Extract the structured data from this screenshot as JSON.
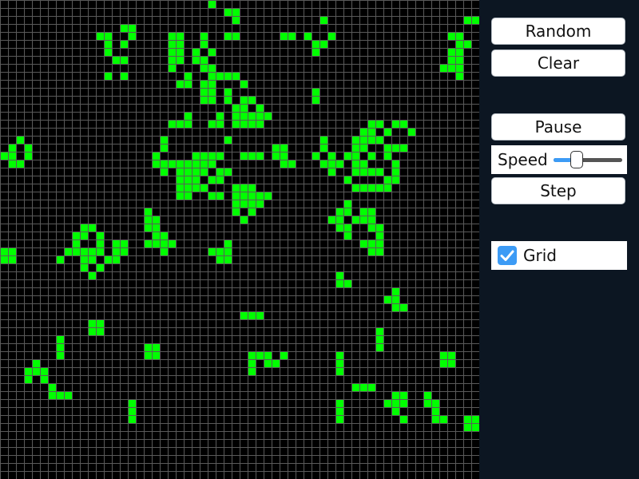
{
  "board": {
    "cols": 60,
    "rows": 60,
    "cell_color": "#00ff00",
    "grid_color": "#5a5a5a",
    "background": "#000000",
    "live_cells": [
      [
        26,
        0
      ],
      [
        28,
        1
      ],
      [
        29,
        1
      ],
      [
        15,
        3
      ],
      [
        16,
        3
      ],
      [
        29,
        2
      ],
      [
        40,
        2
      ],
      [
        58,
        2
      ],
      [
        59,
        2
      ],
      [
        12,
        4
      ],
      [
        13,
        4
      ],
      [
        16,
        4
      ],
      [
        21,
        4
      ],
      [
        22,
        4
      ],
      [
        25,
        4
      ],
      [
        28,
        4
      ],
      [
        29,
        4
      ],
      [
        35,
        4
      ],
      [
        36,
        4
      ],
      [
        38,
        4
      ],
      [
        41,
        4
      ],
      [
        56,
        4
      ],
      [
        57,
        4
      ],
      [
        13,
        5
      ],
      [
        15,
        5
      ],
      [
        21,
        5
      ],
      [
        22,
        5
      ],
      [
        25,
        5
      ],
      [
        39,
        5
      ],
      [
        40,
        5
      ],
      [
        57,
        5
      ],
      [
        58,
        5
      ],
      [
        13,
        6
      ],
      [
        21,
        6
      ],
      [
        22,
        6
      ],
      [
        24,
        6
      ],
      [
        26,
        6
      ],
      [
        39,
        6
      ],
      [
        56,
        6
      ],
      [
        57,
        6
      ],
      [
        15,
        7
      ],
      [
        14,
        7
      ],
      [
        21,
        7
      ],
      [
        22,
        7
      ],
      [
        24,
        7
      ],
      [
        25,
        7
      ],
      [
        56,
        7
      ],
      [
        57,
        7
      ],
      [
        21,
        8
      ],
      [
        25,
        8
      ],
      [
        26,
        8
      ],
      [
        55,
        8
      ],
      [
        56,
        8
      ],
      [
        57,
        8
      ],
      [
        13,
        9
      ],
      [
        15,
        9
      ],
      [
        23,
        9
      ],
      [
        26,
        9
      ],
      [
        27,
        9
      ],
      [
        28,
        9
      ],
      [
        29,
        9
      ],
      [
        57,
        9
      ],
      [
        22,
        10
      ],
      [
        23,
        10
      ],
      [
        25,
        10
      ],
      [
        26,
        10
      ],
      [
        30,
        10
      ],
      [
        25,
        11
      ],
      [
        26,
        11
      ],
      [
        28,
        11
      ],
      [
        39,
        11
      ],
      [
        25,
        12
      ],
      [
        26,
        12
      ],
      [
        28,
        12
      ],
      [
        30,
        12
      ],
      [
        31,
        12
      ],
      [
        39,
        12
      ],
      [
        29,
        13
      ],
      [
        30,
        13
      ],
      [
        32,
        13
      ],
      [
        23,
        14
      ],
      [
        27,
        14
      ],
      [
        29,
        14
      ],
      [
        30,
        14
      ],
      [
        31,
        14
      ],
      [
        32,
        14
      ],
      [
        33,
        14
      ],
      [
        21,
        15
      ],
      [
        22,
        15
      ],
      [
        23,
        15
      ],
      [
        26,
        15
      ],
      [
        27,
        15
      ],
      [
        29,
        15
      ],
      [
        30,
        15
      ],
      [
        31,
        15
      ],
      [
        32,
        15
      ],
      [
        46,
        15
      ],
      [
        47,
        15
      ],
      [
        49,
        15
      ],
      [
        50,
        15
      ],
      [
        45,
        16
      ],
      [
        46,
        16
      ],
      [
        48,
        16
      ],
      [
        51,
        16
      ],
      [
        2,
        17
      ],
      [
        20,
        17
      ],
      [
        28,
        17
      ],
      [
        40,
        17
      ],
      [
        44,
        17
      ],
      [
        45,
        17
      ],
      [
        46,
        17
      ],
      [
        47,
        17
      ],
      [
        1,
        18
      ],
      [
        3,
        18
      ],
      [
        20,
        18
      ],
      [
        34,
        18
      ],
      [
        35,
        18
      ],
      [
        40,
        18
      ],
      [
        44,
        18
      ],
      [
        45,
        18
      ],
      [
        48,
        18
      ],
      [
        49,
        18
      ],
      [
        50,
        18
      ],
      [
        0,
        19
      ],
      [
        1,
        19
      ],
      [
        3,
        19
      ],
      [
        19,
        19
      ],
      [
        24,
        19
      ],
      [
        25,
        19
      ],
      [
        26,
        19
      ],
      [
        27,
        19
      ],
      [
        30,
        19
      ],
      [
        31,
        19
      ],
      [
        32,
        19
      ],
      [
        34,
        19
      ],
      [
        35,
        19
      ],
      [
        39,
        19
      ],
      [
        41,
        19
      ],
      [
        43,
        19
      ],
      [
        44,
        19
      ],
      [
        46,
        19
      ],
      [
        48,
        19
      ],
      [
        1,
        20
      ],
      [
        2,
        20
      ],
      [
        19,
        20
      ],
      [
        20,
        20
      ],
      [
        21,
        20
      ],
      [
        22,
        20
      ],
      [
        23,
        20
      ],
      [
        24,
        20
      ],
      [
        25,
        20
      ],
      [
        26,
        20
      ],
      [
        35,
        20
      ],
      [
        36,
        20
      ],
      [
        40,
        20
      ],
      [
        41,
        20
      ],
      [
        42,
        20
      ],
      [
        44,
        20
      ],
      [
        45,
        20
      ],
      [
        49,
        20
      ],
      [
        20,
        21
      ],
      [
        22,
        21
      ],
      [
        23,
        21
      ],
      [
        24,
        21
      ],
      [
        25,
        21
      ],
      [
        27,
        21
      ],
      [
        28,
        21
      ],
      [
        41,
        21
      ],
      [
        44,
        21
      ],
      [
        45,
        21
      ],
      [
        46,
        21
      ],
      [
        47,
        21
      ],
      [
        49,
        21
      ],
      [
        22,
        22
      ],
      [
        23,
        22
      ],
      [
        24,
        22
      ],
      [
        26,
        22
      ],
      [
        27,
        22
      ],
      [
        43,
        22
      ],
      [
        48,
        22
      ],
      [
        49,
        22
      ],
      [
        22,
        23
      ],
      [
        23,
        23
      ],
      [
        24,
        23
      ],
      [
        25,
        23
      ],
      [
        29,
        23
      ],
      [
        30,
        23
      ],
      [
        31,
        23
      ],
      [
        44,
        23
      ],
      [
        45,
        23
      ],
      [
        46,
        23
      ],
      [
        47,
        23
      ],
      [
        48,
        23
      ],
      [
        22,
        24
      ],
      [
        23,
        24
      ],
      [
        26,
        24
      ],
      [
        27,
        24
      ],
      [
        29,
        24
      ],
      [
        30,
        24
      ],
      [
        31,
        24
      ],
      [
        32,
        24
      ],
      [
        33,
        24
      ],
      [
        29,
        25
      ],
      [
        30,
        25
      ],
      [
        31,
        25
      ],
      [
        32,
        25
      ],
      [
        43,
        25
      ],
      [
        18,
        26
      ],
      [
        29,
        26
      ],
      [
        31,
        26
      ],
      [
        42,
        26
      ],
      [
        43,
        26
      ],
      [
        45,
        26
      ],
      [
        46,
        26
      ],
      [
        18,
        27
      ],
      [
        19,
        27
      ],
      [
        30,
        27
      ],
      [
        41,
        27
      ],
      [
        42,
        27
      ],
      [
        44,
        27
      ],
      [
        45,
        27
      ],
      [
        46,
        27
      ],
      [
        10,
        28
      ],
      [
        11,
        28
      ],
      [
        18,
        28
      ],
      [
        19,
        28
      ],
      [
        42,
        28
      ],
      [
        43,
        28
      ],
      [
        46,
        28
      ],
      [
        47,
        28
      ],
      [
        9,
        29
      ],
      [
        10,
        29
      ],
      [
        12,
        29
      ],
      [
        19,
        29
      ],
      [
        20,
        29
      ],
      [
        43,
        29
      ],
      [
        47,
        29
      ],
      [
        9,
        30
      ],
      [
        12,
        30
      ],
      [
        14,
        30
      ],
      [
        15,
        30
      ],
      [
        18,
        30
      ],
      [
        19,
        30
      ],
      [
        20,
        30
      ],
      [
        21,
        30
      ],
      [
        28,
        30
      ],
      [
        45,
        30
      ],
      [
        46,
        30
      ],
      [
        47,
        30
      ],
      [
        0,
        31
      ],
      [
        1,
        31
      ],
      [
        8,
        31
      ],
      [
        9,
        31
      ],
      [
        10,
        31
      ],
      [
        11,
        31
      ],
      [
        12,
        31
      ],
      [
        14,
        31
      ],
      [
        15,
        31
      ],
      [
        20,
        31
      ],
      [
        26,
        31
      ],
      [
        27,
        31
      ],
      [
        28,
        31
      ],
      [
        46,
        31
      ],
      [
        47,
        31
      ],
      [
        0,
        32
      ],
      [
        1,
        32
      ],
      [
        7,
        32
      ],
      [
        10,
        32
      ],
      [
        11,
        32
      ],
      [
        13,
        32
      ],
      [
        14,
        32
      ],
      [
        27,
        32
      ],
      [
        28,
        32
      ],
      [
        10,
        33
      ],
      [
        12,
        33
      ],
      [
        11,
        34
      ],
      [
        42,
        34
      ],
      [
        42,
        35
      ],
      [
        43,
        35
      ],
      [
        49,
        36
      ],
      [
        48,
        37
      ],
      [
        49,
        37
      ],
      [
        49,
        38
      ],
      [
        50,
        38
      ],
      [
        30,
        39
      ],
      [
        31,
        39
      ],
      [
        32,
        39
      ],
      [
        11,
        40
      ],
      [
        12,
        40
      ],
      [
        11,
        41
      ],
      [
        12,
        41
      ],
      [
        47,
        41
      ],
      [
        7,
        42
      ],
      [
        47,
        42
      ],
      [
        7,
        43
      ],
      [
        18,
        43
      ],
      [
        19,
        43
      ],
      [
        47,
        43
      ],
      [
        7,
        44
      ],
      [
        18,
        44
      ],
      [
        19,
        44
      ],
      [
        31,
        44
      ],
      [
        32,
        44
      ],
      [
        33,
        44
      ],
      [
        35,
        44
      ],
      [
        42,
        44
      ],
      [
        55,
        44
      ],
      [
        56,
        44
      ],
      [
        4,
        45
      ],
      [
        31,
        45
      ],
      [
        33,
        45
      ],
      [
        34,
        45
      ],
      [
        42,
        45
      ],
      [
        55,
        45
      ],
      [
        56,
        45
      ],
      [
        3,
        46
      ],
      [
        4,
        46
      ],
      [
        5,
        46
      ],
      [
        31,
        46
      ],
      [
        42,
        46
      ],
      [
        3,
        47
      ],
      [
        5,
        47
      ],
      [
        6,
        48
      ],
      [
        44,
        48
      ],
      [
        45,
        48
      ],
      [
        46,
        48
      ],
      [
        6,
        49
      ],
      [
        7,
        49
      ],
      [
        8,
        49
      ],
      [
        49,
        49
      ],
      [
        50,
        49
      ],
      [
        53,
        49
      ],
      [
        16,
        50
      ],
      [
        42,
        50
      ],
      [
        48,
        50
      ],
      [
        49,
        50
      ],
      [
        50,
        50
      ],
      [
        53,
        50
      ],
      [
        54,
        50
      ],
      [
        16,
        51
      ],
      [
        42,
        51
      ],
      [
        49,
        51
      ],
      [
        54,
        51
      ],
      [
        16,
        52
      ],
      [
        42,
        52
      ],
      [
        50,
        52
      ],
      [
        54,
        52
      ],
      [
        55,
        52
      ],
      [
        58,
        52
      ],
      [
        59,
        52
      ],
      [
        58,
        53
      ],
      [
        59,
        53
      ]
    ]
  },
  "controls": {
    "random_label": "Random",
    "clear_label": "Clear",
    "pause_label": "Pause",
    "speed_label": "Speed",
    "speed_value": 0.34,
    "step_label": "Step",
    "grid_label": "Grid",
    "grid_checked": true,
    "accent_color": "#3c9bf5"
  }
}
